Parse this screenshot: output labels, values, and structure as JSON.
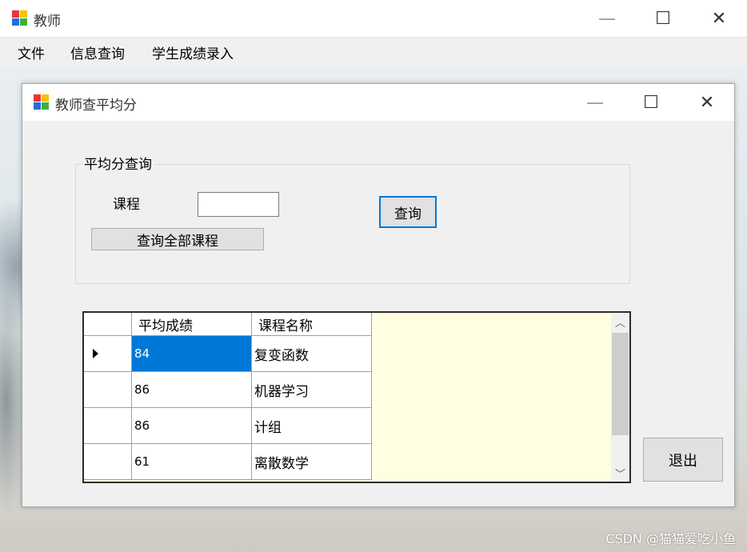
{
  "main_window": {
    "title": "教师",
    "menu": [
      "文件",
      "信息查询",
      "学生成绩录入"
    ]
  },
  "child_window": {
    "title": "教师查平均分",
    "group_title": "平均分查询",
    "course_label": "课程",
    "course_input_value": "",
    "query_button": "查询",
    "query_all_button": "查询全部课程",
    "exit_button": "退出"
  },
  "grid": {
    "columns": [
      "平均成绩",
      "课程名称"
    ],
    "rows": [
      {
        "avg": "84",
        "course": "复变函数",
        "selected": true
      },
      {
        "avg": "86",
        "course": "机器学习"
      },
      {
        "avg": "86",
        "course": "计组"
      },
      {
        "avg": "61",
        "course": "离散数学"
      }
    ]
  },
  "watermark": "CSDN @猫猫爱吃小鱼",
  "colors": {
    "selection": "#0078d7",
    "grid_background": "#fffee0",
    "focus_border": "#0078d7"
  },
  "icons": [
    "app-icon",
    "minimize-icon",
    "maximize-icon",
    "close-icon",
    "row-indicator-icon",
    "scroll-up-icon",
    "scroll-down-icon"
  ]
}
